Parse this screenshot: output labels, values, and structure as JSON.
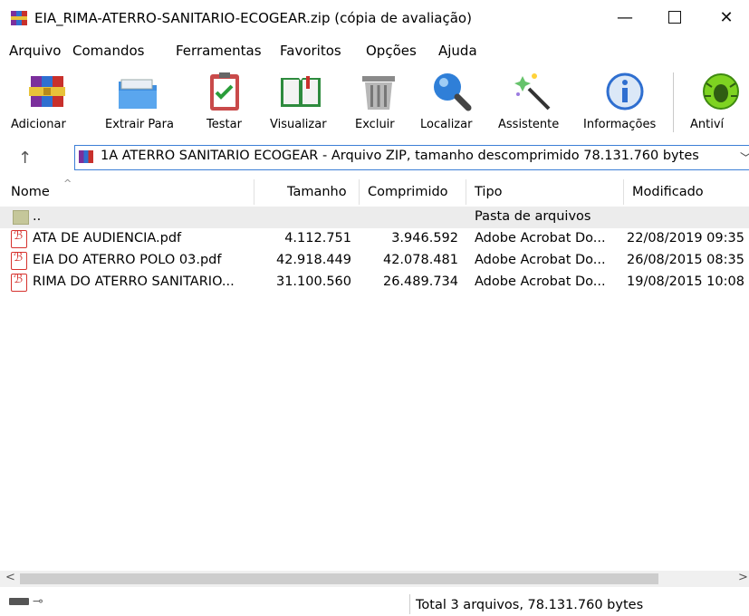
{
  "window": {
    "title": "EIA_RIMA-ATERRO-SANITARIO-ECOGEAR.zip (cópia de avaliação)",
    "min_glyph": "—",
    "close_glyph": "✕"
  },
  "menu": {
    "items": [
      {
        "label": "Arquivo"
      },
      {
        "label": "Comandos"
      },
      {
        "label": "Ferramentas"
      },
      {
        "label": "Favoritos"
      },
      {
        "label": "Opções"
      },
      {
        "label": "Ajuda"
      }
    ]
  },
  "toolbar": {
    "items": [
      {
        "label": "Adicionar",
        "icon": "add-archive-icon"
      },
      {
        "label": "Extrair Para",
        "icon": "extract-folder-icon"
      },
      {
        "label": "Testar",
        "icon": "test-clipboard-icon"
      },
      {
        "label": "Visualizar",
        "icon": "view-book-icon"
      },
      {
        "label": "Excluir",
        "icon": "delete-trash-icon"
      },
      {
        "label": "Localizar",
        "icon": "find-magnifier-icon"
      },
      {
        "label": "Assistente",
        "icon": "wizard-wand-icon"
      },
      {
        "label": "Informações",
        "icon": "info-icon"
      },
      {
        "label": "Antiví",
        "icon": "antivirus-bug-icon"
      }
    ]
  },
  "address": {
    "up_glyph": "↑",
    "text": "1A ATERRO SANITARIO ECOGEAR - Arquivo ZIP, tamanho descomprimido 78.131.760 bytes",
    "dropdown_glyph": "﹀"
  },
  "columns": {
    "name": "Nome",
    "size": "Tamanho",
    "packed": "Comprimido",
    "type": "Tipo",
    "modified": "Modificado",
    "sort_glyph": "^"
  },
  "files": [
    {
      "name": "..",
      "size": "",
      "packed": "",
      "type": "Pasta de arquivos",
      "modified": "",
      "kind": "folder"
    },
    {
      "name": "ATA DE AUDIENCIA.pdf",
      "size": "4.112.751",
      "packed": "3.946.592",
      "type": "Adobe Acrobat Do...",
      "modified": "22/08/2019 09:35",
      "kind": "pdf"
    },
    {
      "name": "EIA DO ATERRO  POLO 03.pdf",
      "size": "42.918.449",
      "packed": "42.078.481",
      "type": "Adobe Acrobat Do...",
      "modified": "26/08/2015 08:35",
      "kind": "pdf"
    },
    {
      "name": "RIMA DO ATERRO SANITARIO...",
      "size": "31.100.560",
      "packed": "26.489.734",
      "type": "Adobe Acrobat Do...",
      "modified": "19/08/2015 10:08",
      "kind": "pdf"
    }
  ],
  "scroll": {
    "left_glyph": "<",
    "right_glyph": ">"
  },
  "status": {
    "key_glyph": "⊸",
    "text": "Total 3 arquivos, 78.131.760 bytes"
  }
}
